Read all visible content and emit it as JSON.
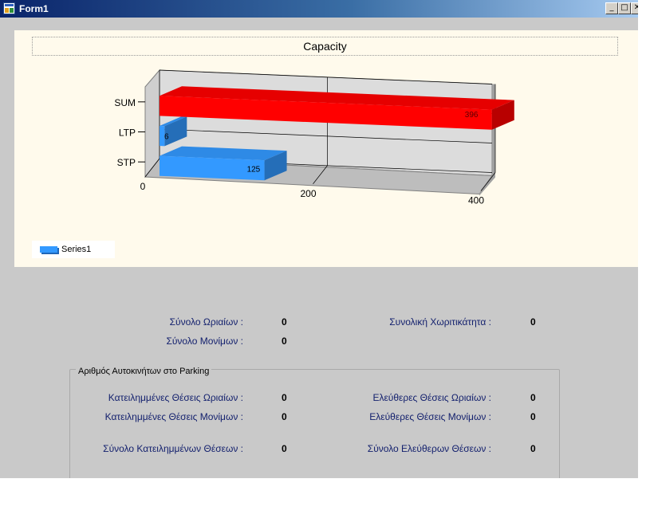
{
  "window": {
    "title": "Form1",
    "min_glyph": "_",
    "max_glyph": "□",
    "close_glyph": "✕"
  },
  "chart": {
    "title": "Capacity",
    "legend_label": "Series1",
    "colors": {
      "STP": "#3399ff",
      "LTP": "#3399ff",
      "SUM": "#ff0000"
    }
  },
  "chart_data": {
    "type": "bar",
    "orientation": "horizontal-3d",
    "title": "Capacity",
    "categories": [
      "STP",
      "LTP",
      "SUM"
    ],
    "series": [
      {
        "name": "Series1",
        "values": [
          125,
          6,
          396
        ]
      }
    ],
    "data_labels": [
      "125",
      "6",
      "396"
    ],
    "x_ticks": [
      "0",
      "200",
      "400"
    ],
    "xlim": [
      0,
      400
    ],
    "legend": "bottom-left",
    "grid": true
  },
  "stats": {
    "total_hourly_label": "Σύνολο Ωριαίων :",
    "total_hourly_value": "0",
    "total_permanent_label": "Σύνολο Μονίμων :",
    "total_permanent_value": "0",
    "total_capacity_label": "Συνολική Χωριτικάτητα :",
    "total_capacity_value": "0"
  },
  "parking": {
    "group_title": "Αριθμός Αυτοκινήτων στο Parking",
    "occupied_hourly_label": "Κατειλημμένες Θέσεις Ωριαίων :",
    "occupied_hourly_value": "0",
    "occupied_permanent_label": "Κατειλημμένες Θέσεις Μονίμων :",
    "occupied_permanent_value": "0",
    "occupied_total_label": "Σύνολο Κατειλημμένων Θέσεων :",
    "occupied_total_value": "0",
    "free_hourly_label": "Ελεύθερες Θέσεις Ωριαίων :",
    "free_hourly_value": "0",
    "free_permanent_label": "Ελεύθερες Θέσεις Μονίμων :",
    "free_permanent_value": "0",
    "free_total_label": "Σύνολο Ελεύθερων Θέσεων :",
    "free_total_value": "0"
  }
}
